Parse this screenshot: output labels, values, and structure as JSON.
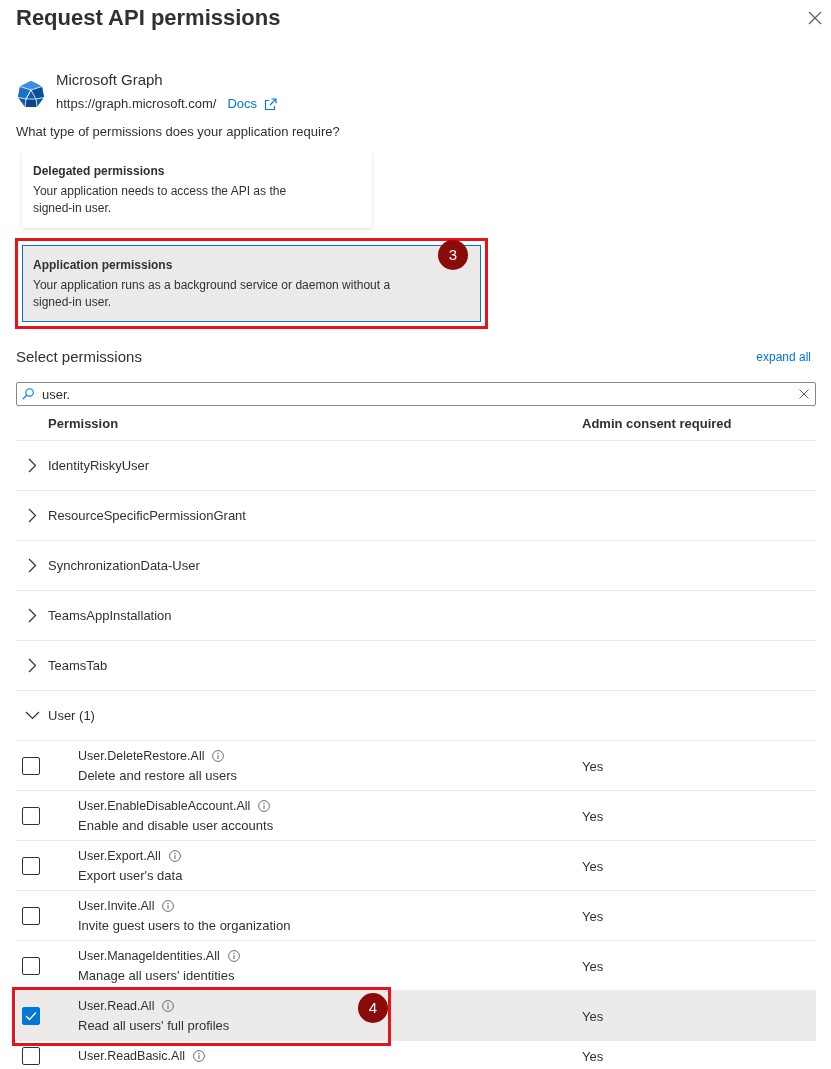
{
  "dialog": {
    "title": "Request API permissions"
  },
  "api": {
    "name": "Microsoft Graph",
    "url": "https://graph.microsoft.com/",
    "docs_link": "Docs"
  },
  "question": "What type of permissions does your application require?",
  "permission_types": [
    {
      "title": "Delegated permissions",
      "description": "Your application needs to access the API as the signed-in user.",
      "selected": false
    },
    {
      "title": "Application permissions",
      "description": "Your application runs as a background service or daemon without a signed-in user.",
      "selected": true,
      "callout": "3"
    }
  ],
  "select_permissions": {
    "heading": "Select permissions",
    "expand_all": "expand all",
    "search": {
      "value": "user."
    }
  },
  "table": {
    "columns": [
      "Permission",
      "Admin consent required"
    ],
    "groups": [
      {
        "name": "IdentityRiskyUser",
        "expanded": false
      },
      {
        "name": "ResourceSpecificPermissionGrant",
        "expanded": false
      },
      {
        "name": "SynchronizationData-User",
        "expanded": false
      },
      {
        "name": "TeamsAppInstallation",
        "expanded": false
      },
      {
        "name": "TeamsTab",
        "expanded": false
      },
      {
        "name": "User (1)",
        "expanded": true,
        "permissions": [
          {
            "name": "User.DeleteRestore.All",
            "description": "Delete and restore all users",
            "admin_consent": "Yes",
            "checked": false
          },
          {
            "name": "User.EnableDisableAccount.All",
            "description": "Enable and disable user accounts",
            "admin_consent": "Yes",
            "checked": false
          },
          {
            "name": "User.Export.All",
            "description": "Export user's data",
            "admin_consent": "Yes",
            "checked": false
          },
          {
            "name": "User.Invite.All",
            "description": "Invite guest users to the organization",
            "admin_consent": "Yes",
            "checked": false
          },
          {
            "name": "User.ManageIdentities.All",
            "description": "Manage all users' identities",
            "admin_consent": "Yes",
            "checked": false
          },
          {
            "name": "User.Read.All",
            "description": "Read all users' full profiles",
            "admin_consent": "Yes",
            "checked": true,
            "callout": "4"
          },
          {
            "name": "User.ReadBasic.All",
            "admin_consent": "Yes",
            "checked": false
          }
        ]
      }
    ]
  }
}
